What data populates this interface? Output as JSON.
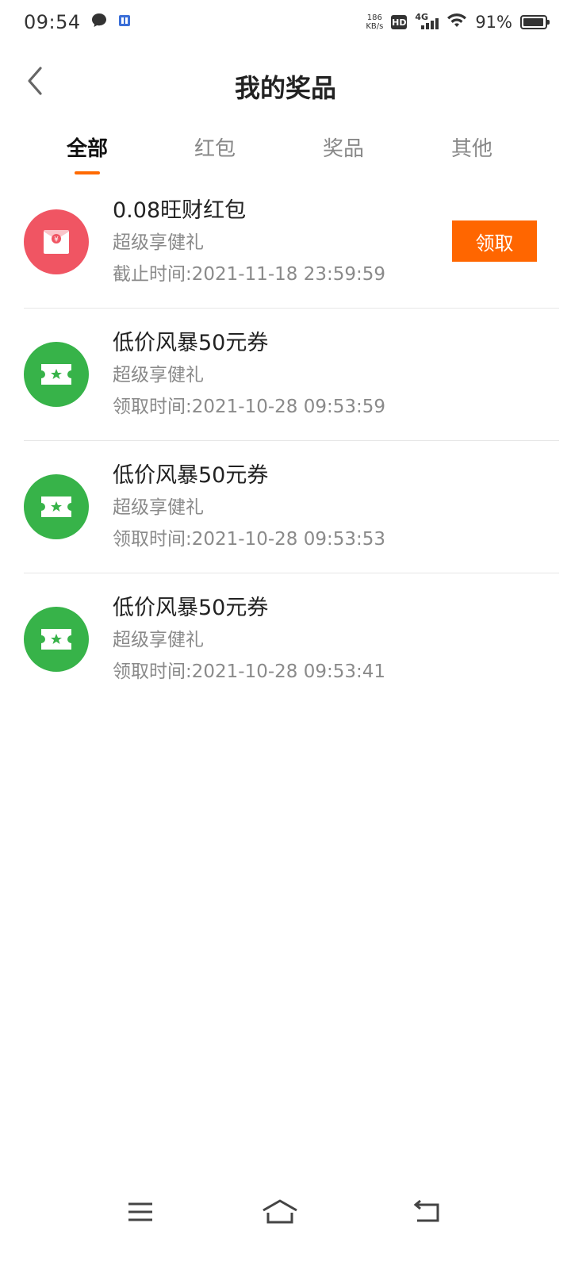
{
  "status_bar": {
    "time": "09:54",
    "net_speed_value": "186",
    "net_speed_unit": "KB/s",
    "hd_label": "HD",
    "network_label": "4G",
    "battery_percent": "91%",
    "battery_level": 0.91
  },
  "header": {
    "title": "我的奖品"
  },
  "tabs": [
    {
      "label": "全部",
      "active": true
    },
    {
      "label": "红包",
      "active": false
    },
    {
      "label": "奖品",
      "active": false
    },
    {
      "label": "其他",
      "active": false
    }
  ],
  "prizes": [
    {
      "icon": "red-envelope-icon",
      "title": "0.08旺财红包",
      "subtitle": "超级享健礼",
      "time": "截止时间:2021-11-18 23:59:59",
      "action_label": "领取"
    },
    {
      "icon": "ticket-icon",
      "title": "低价风暴50元券",
      "subtitle": "超级享健礼",
      "time": "领取时间:2021-10-28 09:53:59"
    },
    {
      "icon": "ticket-icon",
      "title": "低价风暴50元券",
      "subtitle": "超级享健礼",
      "time": "领取时间:2021-10-28 09:53:53"
    },
    {
      "icon": "ticket-icon",
      "title": "低价风暴50元券",
      "subtitle": "超级享健礼",
      "time": "领取时间:2021-10-28 09:53:41"
    }
  ],
  "colors": {
    "accent": "#ff6600",
    "red_icon_bg": "#f05563",
    "green_icon_bg": "#37b349"
  }
}
